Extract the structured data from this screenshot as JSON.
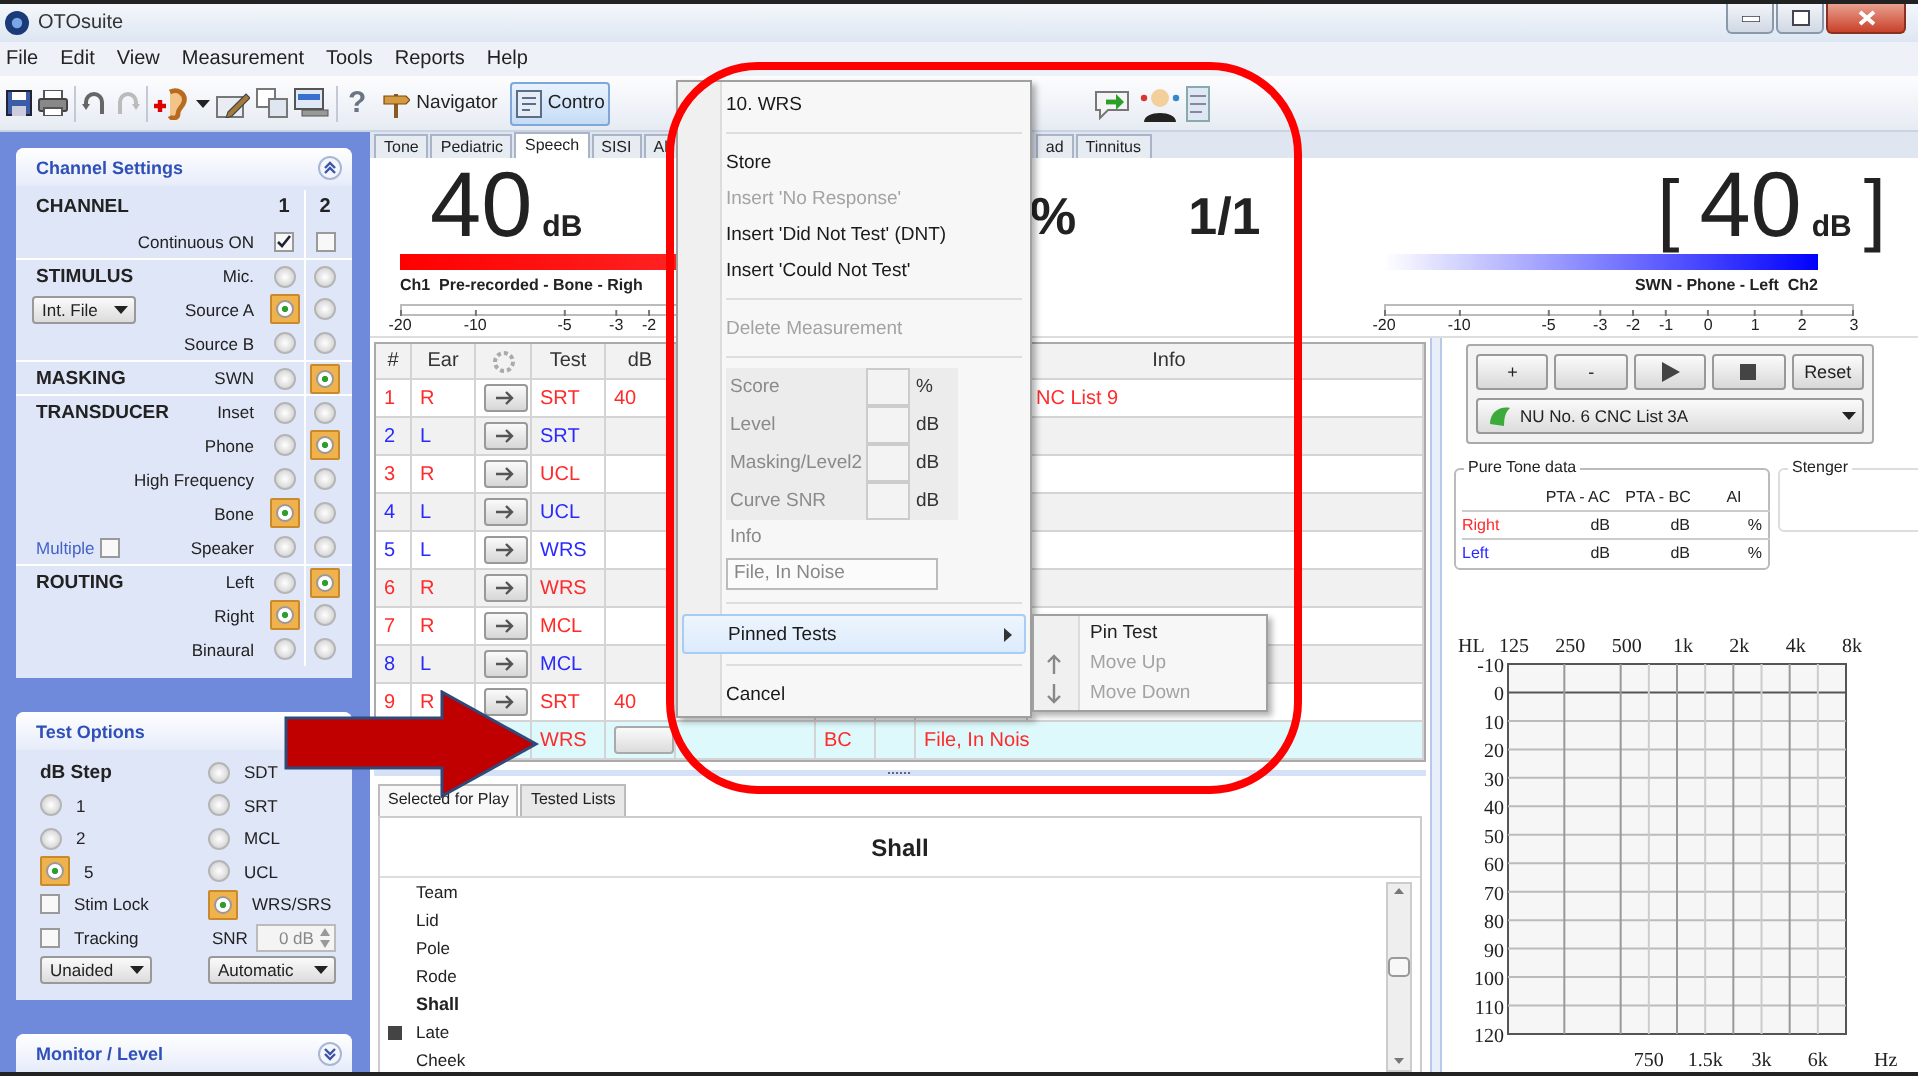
{
  "window": {
    "app_name": "OTOsuite"
  },
  "menu_bar": [
    "File",
    "Edit",
    "View",
    "Measurement",
    "Tools",
    "Reports",
    "Help"
  ],
  "toolbar": {
    "help": "?",
    "navigator": "Navigator",
    "control": {
      "label": "Contro",
      "selected": true
    }
  },
  "channel_settings": {
    "title": "Channel Settings",
    "rows": [
      {
        "kind": "header",
        "section": "CHANNEL",
        "channels": [
          "1",
          "2"
        ]
      },
      {
        "kind": "checkbox",
        "label": "Continuous ON",
        "channels": [
          {
            "checked": true
          },
          {
            "checked": false
          }
        ]
      },
      {
        "kind": "radio",
        "section": "STIMULUS",
        "label": "Mic.",
        "channels": [
          {
            "selected": false
          },
          {
            "selected": false
          }
        ]
      },
      {
        "kind": "radio",
        "label": "Source A",
        "dropdown": "Int. File",
        "channels": [
          {
            "selected": true
          },
          {
            "selected": false
          }
        ]
      },
      {
        "kind": "radio",
        "label": "Source B",
        "channels": [
          {
            "selected": false
          },
          {
            "selected": false
          }
        ]
      },
      {
        "kind": "radio",
        "section": "MASKING",
        "label": "SWN",
        "channels": [
          {
            "selected": false
          },
          {
            "selected": true
          }
        ]
      },
      {
        "kind": "radio",
        "section": "TRANSDUCER",
        "label": "Inset",
        "channels": [
          {
            "selected": false
          },
          {
            "selected": false
          }
        ]
      },
      {
        "kind": "radio",
        "label": "Phone",
        "channels": [
          {
            "selected": false
          },
          {
            "selected": true
          }
        ]
      },
      {
        "kind": "radio",
        "label": "High Frequency",
        "channels": [
          {
            "selected": false
          },
          {
            "selected": false
          }
        ]
      },
      {
        "kind": "radio",
        "label": "Bone",
        "channels": [
          {
            "selected": true
          },
          {
            "selected": false
          }
        ]
      },
      {
        "kind": "radio",
        "label": "Speaker",
        "option": {
          "label": "Multiple",
          "checked": false
        },
        "channels": [
          {
            "selected": false
          },
          {
            "selected": false
          }
        ]
      },
      {
        "kind": "radio",
        "section": "ROUTING",
        "label": "Left",
        "channels": [
          {
            "selected": false
          },
          {
            "selected": true
          }
        ]
      },
      {
        "kind": "radio",
        "label": "Right",
        "channels": [
          {
            "selected": true
          },
          {
            "selected": false
          }
        ]
      },
      {
        "kind": "radio",
        "label": "Binaural",
        "channels": [
          {
            "selected": false
          },
          {
            "selected": false
          }
        ]
      }
    ]
  },
  "test_options": {
    "title": "Test Options",
    "step_label": "dB Step",
    "steps": [
      {
        "label": "1",
        "selected": false
      },
      {
        "label": "2",
        "selected": false
      },
      {
        "label": "5",
        "selected": true
      }
    ],
    "checks": [
      {
        "label": "Stim Lock",
        "checked": false
      },
      {
        "label": "Tracking",
        "checked": false
      }
    ],
    "aided_dropdown": "Unaided",
    "tests": [
      {
        "label": "SDT",
        "selected": false
      },
      {
        "label": "SRT",
        "selected": false
      },
      {
        "label": "MCL",
        "selected": false
      },
      {
        "label": "UCL",
        "selected": false
      },
      {
        "label": "WRS/SRS",
        "selected": true
      }
    ],
    "snr": {
      "label": "SNR",
      "value": "0 dB"
    },
    "mode_dropdown": "Automatic"
  },
  "monitor": {
    "title": "Monitor / Level"
  },
  "tabs": [
    {
      "label": "Tone",
      "selected": false
    },
    {
      "label": "Pediatric",
      "selected": false
    },
    {
      "label": "Speech",
      "selected": true
    },
    {
      "label": "SISI",
      "selected": false
    },
    {
      "label": "Al",
      "selected": false
    },
    {
      "label": "ad",
      "selected": false
    },
    {
      "label": "Tinnitus",
      "selected": false
    }
  ],
  "display": {
    "left": {
      "value": "40",
      "unit": "dB",
      "caption": "Ch1  Pre-recorded - Bone - Righ",
      "scale": [
        "-20",
        "-10",
        "-5",
        "-3",
        "-2"
      ]
    },
    "score": "%",
    "count": "1/1",
    "right": {
      "open_bracket": "[",
      "value": "40",
      "unit": "dB",
      "close_bracket": "]",
      "caption": "SWN - Phone - Left  Ch2",
      "scale": [
        "-20",
        "-10",
        "-5",
        "-3",
        "-2",
        "-1",
        "0",
        "1",
        "2",
        "3"
      ]
    }
  },
  "table": {
    "columns": [
      "#",
      "Ear",
      "Test",
      "dB",
      "Info"
    ],
    "rows": [
      {
        "kind": "stored",
        "number": "1",
        "ear": "R",
        "test": "SRT",
        "db": "40",
        "info": "NC List 9",
        "color": "#ff2a2a",
        "selected": false
      },
      {
        "kind": "stored",
        "number": "2",
        "ear": "L",
        "test": "SRT",
        "color": "#2a2aff",
        "selected": false
      },
      {
        "kind": "stored",
        "number": "3",
        "ear": "R",
        "test": "UCL",
        "color": "#ff2a2a",
        "selected": false
      },
      {
        "kind": "stored",
        "number": "4",
        "ear": "L",
        "test": "UCL",
        "color": "#2a2aff",
        "selected": false
      },
      {
        "kind": "stored",
        "number": "5",
        "ear": "L",
        "test": "WRS",
        "color": "#2a2aff",
        "selected": false
      },
      {
        "kind": "stored",
        "number": "6",
        "ear": "R",
        "test": "WRS",
        "color": "#ff2a2a",
        "selected": false
      },
      {
        "kind": "stored",
        "number": "7",
        "ear": "R",
        "test": "MCL",
        "color": "#ff2a2a",
        "selected": false
      },
      {
        "kind": "stored",
        "number": "8",
        "ear": "L",
        "test": "MCL",
        "color": "#2a2aff",
        "selected": false
      },
      {
        "kind": "stored",
        "number": "9",
        "ear": "R",
        "test": "SRT",
        "db": "40",
        "color": "#ff2a2a",
        "selected": false
      },
      {
        "kind": "current",
        "test": "WRS",
        "column_7": "BC",
        "info": "File, In Nois",
        "color": "#ff2a2a",
        "selected": true
      }
    ]
  },
  "context_menu": {
    "items": [
      {
        "kind": "title",
        "label": "10. WRS"
      },
      {
        "kind": "separator"
      },
      {
        "kind": "item",
        "label": "Store",
        "disabled": false
      },
      {
        "kind": "item",
        "label": "Insert 'No Response'",
        "disabled": true
      },
      {
        "kind": "item",
        "label": "Insert 'Did Not Test' (DNT)",
        "disabled": false
      },
      {
        "kind": "item",
        "label": "Insert 'Could Not Test'",
        "disabled": false
      },
      {
        "kind": "separator"
      },
      {
        "kind": "item",
        "label": "Delete Measurement",
        "disabled": true
      },
      {
        "kind": "separator"
      },
      {
        "kind": "fields",
        "fields": [
          {
            "label": "Score",
            "unit": "%"
          },
          {
            "label": "Level",
            "unit": "dB"
          },
          {
            "label": "Masking/Level2",
            "unit": "dB"
          },
          {
            "label": "Curve SNR",
            "unit": "dB"
          }
        ]
      },
      {
        "kind": "caption",
        "label": "Info"
      },
      {
        "kind": "input",
        "value": "File, In Noise"
      },
      {
        "kind": "separator"
      },
      {
        "kind": "submenu",
        "label": "Pinned Tests",
        "selected": true
      },
      {
        "kind": "separator"
      },
      {
        "kind": "item",
        "label": "Cancel",
        "disabled": false
      }
    ],
    "submenu": [
      {
        "kind": "plain",
        "label": "Pin Test",
        "disabled": false
      },
      {
        "kind": "arrow_up",
        "label": "Move Up",
        "disabled": true
      },
      {
        "kind": "arrow_down",
        "label": "Move Down",
        "disabled": true
      }
    ]
  },
  "word_panel": {
    "tabs": [
      {
        "label": "Selected for Play",
        "selected": true
      },
      {
        "label": "Tested Lists",
        "selected": false
      }
    ],
    "heading": "Shall",
    "words": [
      {
        "text": "Team",
        "current": false,
        "marked": false
      },
      {
        "text": "Lid",
        "current": false,
        "marked": false
      },
      {
        "text": "Pole",
        "current": false,
        "marked": false
      },
      {
        "text": "Rode",
        "current": false,
        "marked": false
      },
      {
        "text": "Shall",
        "current": true,
        "marked": false
      },
      {
        "text": "Late",
        "current": false,
        "marked": true
      },
      {
        "text": "Cheek",
        "current": false,
        "marked": false
      }
    ]
  },
  "controls": {
    "buttons": [
      {
        "kind": "text",
        "label": "+"
      },
      {
        "kind": "text",
        "label": "-"
      },
      {
        "kind": "play"
      },
      {
        "kind": "stop"
      },
      {
        "kind": "text",
        "label": "Reset"
      }
    ],
    "word_list": "NU No. 6 CNC List 3A"
  },
  "pure_tone": {
    "title": "Pure Tone data",
    "columns": [
      "PTA - AC",
      "PTA - BC",
      "AI"
    ],
    "rows": [
      {
        "ear": "Right",
        "color": "#ff2a2a",
        "cells": [
          "dB",
          "dB",
          "%"
        ]
      },
      {
        "ear": "Left",
        "color": "#2a2aff",
        "cells": [
          "dB",
          "dB",
          "%"
        ]
      }
    ]
  },
  "stenger": {
    "title": "Stenger"
  },
  "audiogram": {
    "axis": "HL",
    "top_labels": [
      "125",
      "250",
      "500",
      "1k",
      "2k",
      "4k",
      "8k"
    ],
    "y_labels": [
      "-10",
      "0",
      "10",
      "20",
      "30",
      "40",
      "50",
      "60",
      "70",
      "80",
      "90",
      "100",
      "110",
      "120"
    ],
    "bottom_labels": [
      "750",
      "1.5k",
      "3k",
      "6k"
    ],
    "unit": "Hz"
  }
}
